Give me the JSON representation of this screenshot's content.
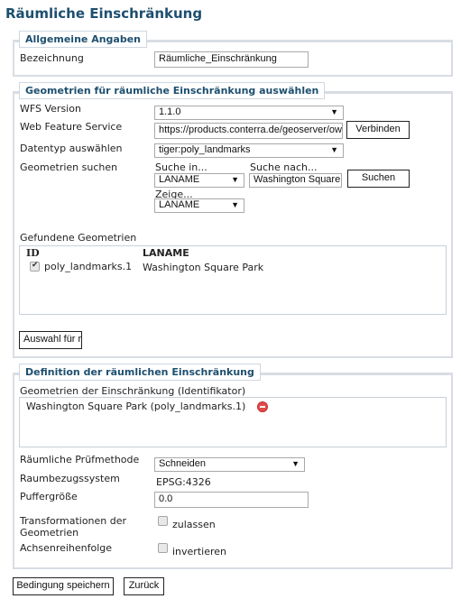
{
  "page_title": "Räumliche Einschränkung",
  "general": {
    "legend": "Allgemeine Angaben",
    "name_label": "Bezeichnung",
    "name_value": "Räumliche_Einschränkung"
  },
  "select_geometries": {
    "legend": "Geometrien für räumliche Einschränkung auswählen",
    "wfs_version_label": "WFS Version",
    "wfs_version_value": "1.1.0",
    "wfs_label": "Web Feature Service",
    "wfs_url": "https://products.conterra.de/geoserver/ows",
    "connect_button": "Verbinden",
    "datatype_label": "Datentyp auswählen",
    "datatype_value": "tiger:poly_landmarks",
    "search_label": "Geometrien suchen",
    "search_in_label": "Suche in...",
    "search_in_value": "LANAME",
    "search_for_label": "Suche nach...",
    "search_for_value": "Washington Square P",
    "search_button": "Suchen",
    "show_label": "Zeige...",
    "show_value": "LANAME",
    "found_label": "Gefundene Geometrien",
    "results": {
      "columns": [
        "ID",
        "LANAME"
      ],
      "rows": [
        {
          "id": "poly_landmarks.1",
          "laname": "Washington Square Park",
          "checked": true
        }
      ]
    },
    "apply_button": "Auswahl für r"
  },
  "definition": {
    "legend": "Definition der räumlichen Einschränkung",
    "geometries_label": "Geometrien der Einschränkung (Identifikator)",
    "geometries": [
      {
        "text": "Washington Square Park (poly_landmarks.1)",
        "icon": "remove-icon"
      }
    ],
    "method_label": "Räumliche Prüfmethode",
    "method_value": "Schneiden",
    "crs_label": "Raumbezugssystem",
    "crs_value": "EPSG:4326",
    "buffer_label": "Puffergröße",
    "buffer_value": "0.0",
    "transform_label_1": "Transformationen der",
    "transform_label_2": "Geometrien",
    "transform_option": "zulassen",
    "transform_checked": false,
    "axis_label": "Achsenreihenfolge",
    "axis_option": "invertieren",
    "axis_checked": false
  },
  "footer": {
    "save_button": "Bedingung speichern",
    "back_button": "Zurück"
  }
}
